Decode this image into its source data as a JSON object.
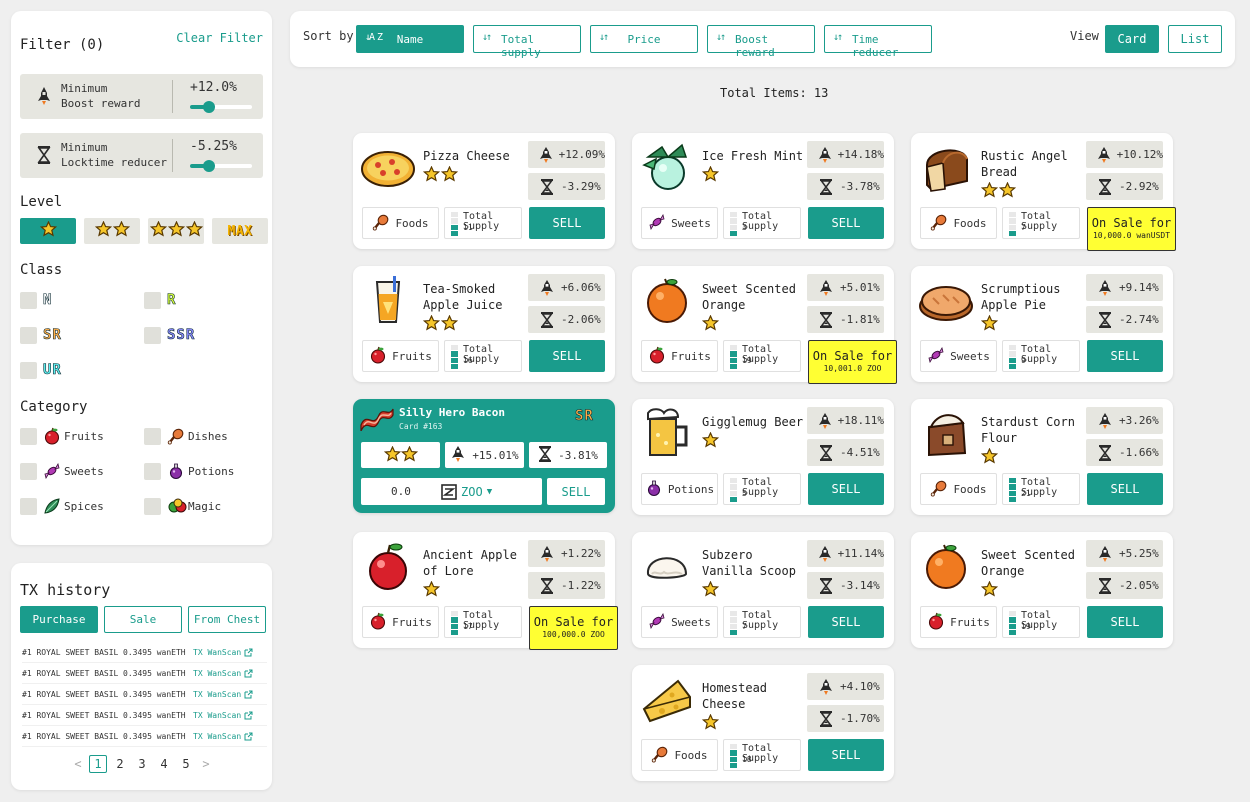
{
  "filter": {
    "title": "Filter (0)",
    "clear_label": "Clear Filter",
    "boost": {
      "label1": "Minimum",
      "label2": "Boost reward",
      "value": "+12.0%",
      "fraction": 0.3
    },
    "lock": {
      "label1": "Minimum",
      "label2": "Locktime reducer",
      "value": "-5.25%",
      "fraction": 0.3
    },
    "level_title": "Level",
    "level_max_label": "MAX",
    "class_title": "Class",
    "classes": [
      "N",
      "R",
      "SR",
      "SSR",
      "UR"
    ],
    "category_title": "Category",
    "categories": [
      "Fruits",
      "Dishes",
      "Sweets",
      "Potions",
      "Spices",
      "Magic"
    ]
  },
  "tx": {
    "title": "TX history",
    "tabs": [
      "Purchase",
      "Sale",
      "From Chest"
    ],
    "rows": [
      {
        "name": "#1 ROYAL SWEET BASIL",
        "amount": "0.3495 wanETH",
        "link": "TX WanScan"
      },
      {
        "name": "#1 ROYAL SWEET BASIL",
        "amount": "0.3495 wanETH",
        "link": "TX WanScan"
      },
      {
        "name": "#1 ROYAL SWEET BASIL",
        "amount": "0.3495 wanETH",
        "link": "TX WanScan"
      },
      {
        "name": "#1 ROYAL SWEET BASIL",
        "amount": "0.3495 wanETH",
        "link": "TX WanScan"
      },
      {
        "name": "#1 ROYAL SWEET BASIL",
        "amount": "0.3495 wanETH",
        "link": "TX WanScan"
      }
    ],
    "pages": [
      "1",
      "2",
      "3",
      "4",
      "5"
    ],
    "prev": "<",
    "next": ">"
  },
  "sort": {
    "label": "Sort by",
    "buttons": [
      "Name",
      "Total supply",
      "Price",
      "Boost reward",
      "Time reducer"
    ],
    "name_icon": "↓A Z",
    "order_icon": "↓↑",
    "view_label": "View",
    "view_card": "Card",
    "view_list": "List"
  },
  "total_items": "Total Items: 13",
  "colors": {
    "accent": "#1a9c8c",
    "onsale": "#ffff33"
  },
  "supply_label": "Total Supply",
  "sell_label": "SELL",
  "onsale_label": "On Sale for",
  "cards": [
    {
      "name": "Pizza Cheese",
      "stars": 2,
      "boost": "+12.09%",
      "lock": "-3.29%",
      "category": "Foods",
      "supply": "11",
      "icon": "pizza"
    },
    {
      "name": "Ice Fresh Mint",
      "stars": 1,
      "boost": "+14.18%",
      "lock": "-3.78%",
      "category": "Sweets",
      "supply": "3",
      "icon": "mint"
    },
    {
      "name": "Rustic Angel Bread",
      "stars": 2,
      "boost": "+10.12%",
      "lock": "-2.92%",
      "category": "Foods",
      "supply": "7",
      "icon": "bread",
      "sale": "10,000.0 wanUSDT"
    },
    {
      "name": "Tea-Smoked Apple Juice",
      "stars": 2,
      "boost": "+6.06%",
      "lock": "-2.06%",
      "category": "Fruits",
      "supply": "16",
      "icon": "juice"
    },
    {
      "name": "Sweet Scented Orange",
      "stars": 1,
      "boost": "+5.01%",
      "lock": "-1.81%",
      "category": "Fruits",
      "supply": "19",
      "icon": "orange",
      "sale": "10,001.0 ZOO"
    },
    {
      "name": "Scrumptious Apple Pie",
      "stars": 1,
      "boost": "+9.14%",
      "lock": "-2.74%",
      "category": "Sweets",
      "supply": "9",
      "icon": "pie"
    },
    {
      "name": "Gigglemug Beer",
      "stars": 1,
      "boost": "+18.11%",
      "lock": "-4.51%",
      "category": "Potions",
      "supply": "5",
      "icon": "beer"
    },
    {
      "name": "Stardust Corn Flour",
      "stars": 1,
      "boost": "+3.26%",
      "lock": "-1.66%",
      "category": "Foods",
      "supply": "21",
      "icon": "flour"
    },
    {
      "name": "Ancient Apple of Lore",
      "stars": 1,
      "boost": "+1.22%",
      "lock": "-1.22%",
      "category": "Fruits",
      "supply": "17",
      "icon": "apple",
      "sale": "100,000.0 ZOO"
    },
    {
      "name": "Subzero Vanilla Scoop",
      "stars": 1,
      "boost": "+11.14%",
      "lock": "-3.14%",
      "category": "Sweets",
      "supply": "7",
      "icon": "scoop"
    },
    {
      "name": "Sweet Scented Orange",
      "stars": 1,
      "boost": "+5.25%",
      "lock": "-2.05%",
      "category": "Fruits",
      "supply": "19",
      "icon": "orange"
    },
    {
      "name": "Homestead Cheese",
      "stars": 1,
      "boost": "+4.10%",
      "lock": "-1.70%",
      "category": "Foods",
      "supply": "18",
      "icon": "cheese"
    }
  ],
  "selected": {
    "name": "Silly Hero Bacon",
    "card_no": "Card #163",
    "badge": "SR",
    "stars": 2,
    "boost": "+15.01%",
    "lock": "-3.81%",
    "price": "0.0",
    "token": "ZOO",
    "sell": "SELL"
  }
}
